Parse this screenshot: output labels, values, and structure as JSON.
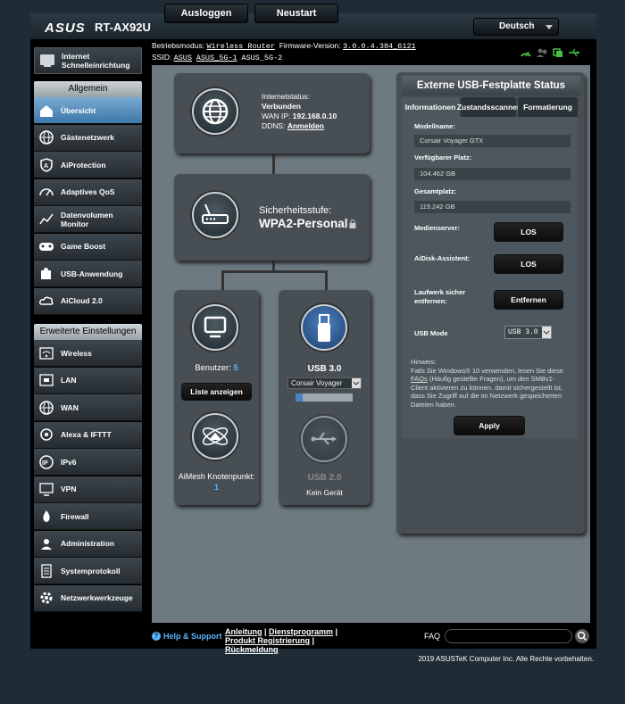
{
  "header": {
    "brand": "ASUS",
    "model": "RT-AX92U",
    "logout_label": "Ausloggen",
    "restart_label": "Neustart",
    "language": "Deutsch"
  },
  "info": {
    "mode_label": "Betriebsmodus:",
    "mode_value": "Wireless Router",
    "firmware_label": "Firmware-Version:",
    "firmware_value": "3.0.0.4.384_6121",
    "ssid_label": "SSID:",
    "ssid1": "ASUS",
    "ssid2": "ASUS_5G-1",
    "ssid3": "ASUS_5G-2"
  },
  "sidebar": {
    "quick": "Internet Schnelleinrichtung",
    "general_header": "Allgemein",
    "general": [
      {
        "label": "Übersicht",
        "icon": "home-icon"
      },
      {
        "label": "Gästenetzwerk",
        "icon": "globe-icon"
      },
      {
        "label": "AiProtection",
        "icon": "shield-icon"
      },
      {
        "label": "Adaptives QoS",
        "icon": "speedometer-icon"
      },
      {
        "label": "Datenvolumen Monitor",
        "icon": "traffic-icon"
      },
      {
        "label": "Game Boost",
        "icon": "gamepad-icon"
      },
      {
        "label": "USB-Anwendung",
        "icon": "puzzle-icon"
      },
      {
        "label": "AiCloud 2.0",
        "icon": "cloud-icon"
      }
    ],
    "advanced_header": "Erweiterte Einstellungen",
    "advanced": [
      {
        "label": "Wireless",
        "icon": "wifi-icon"
      },
      {
        "label": "LAN",
        "icon": "lan-icon"
      },
      {
        "label": "WAN",
        "icon": "globe-icon"
      },
      {
        "label": "Alexa & IFTTT",
        "icon": "alexa-icon"
      },
      {
        "label": "IPv6",
        "icon": "ipv6-icon"
      },
      {
        "label": "VPN",
        "icon": "vpn-icon"
      },
      {
        "label": "Firewall",
        "icon": "fire-icon"
      },
      {
        "label": "Administration",
        "icon": "admin-icon"
      },
      {
        "label": "Systemprotokoll",
        "icon": "log-icon"
      },
      {
        "label": "Netzwerkwerkzeuge",
        "icon": "tools-icon"
      }
    ]
  },
  "network_map": {
    "internet_status_label": "Internetstatus:",
    "internet_status_value": "Verbunden",
    "wan_ip_label": "WAN IP:",
    "wan_ip_value": "192.168.0.10",
    "ddns_label": "DDNS:",
    "ddns_value": "Anmelden",
    "security_label": "Sicherheitsstufe:",
    "security_value": "WPA2-Personal",
    "clients_label": "Benutzer:",
    "clients_count": "5",
    "clients_button": "Liste anzeigen",
    "aimesh_label": "AiMesh Knotenpunkt:",
    "aimesh_count": "1",
    "usb3_label": "USB 3.0",
    "usb3_device": "Corsair Voyager",
    "usb2_label": "USB 2.0",
    "usb2_status": "Kein Gerät"
  },
  "usb_panel": {
    "title": "Externe USB-Festplatte Status",
    "tabs": [
      "Informationen",
      "Zustandsscanner",
      "Formatierung"
    ],
    "model_label": "Modellname:",
    "model_value": "Corsair Voyager GTX",
    "free_label": "Verfügbarer Platz:",
    "free_value": "104.462 GB",
    "total_label": "Gesamtplatz:",
    "total_value": "119.242 GB",
    "media_label": "Medienserver:",
    "media_button": "LOS",
    "aidisk_label": "AiDisk-Assistent:",
    "aidisk_button": "LOS",
    "remove_label": "Laufwerk sicher entfernen:",
    "remove_button": "Entfernen",
    "usbmode_label": "USB Mode",
    "usbmode_value": "USB 3.0",
    "hint_title": "Hinweis:",
    "hint_pre": "Falls Sie Windows® 10 verwenden, lesen Sie diese ",
    "hint_link": "FAQs",
    "hint_post": " (Häufig gestellte Fragen), um den SMBv1-Client aktivieren zu können, damit sichergestellt ist, dass Sie Zugriff auf die im Netzwerk gespeicherten Dateien haben.",
    "apply_button": "Apply"
  },
  "footer": {
    "help": "Help & Support",
    "link1": "Anleitung",
    "link2": "Dienstprogramm",
    "link3": "Produkt Registrierung",
    "link4": "Rückmeldung",
    "faq_label": "FAQ",
    "copyright": "2019 ASUSTeK Computer Inc. Alle Rechte vorbehalten."
  }
}
